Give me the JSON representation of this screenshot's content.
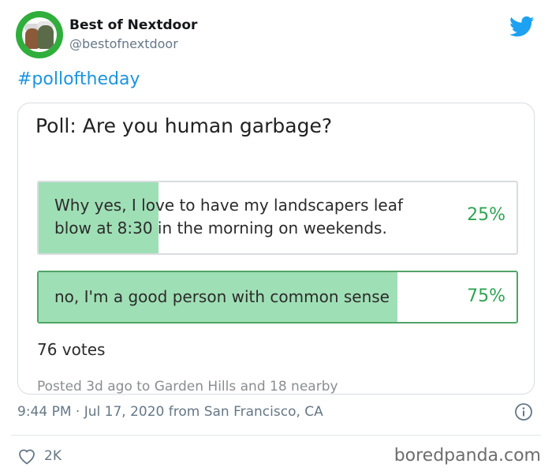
{
  "account": {
    "name": "Best of Nextdoor",
    "handle": "@bestofnextdoor",
    "avatar_icon": "muppets-avatar"
  },
  "tweet": {
    "hashtag": "#polloftheday"
  },
  "poll": {
    "title": "Poll: Are you human garbage?",
    "options": [
      {
        "text": "Why yes, I love to have my landscapers leaf blow at 8:30 in the morning on weekends.",
        "percent_label": "25%",
        "fraction": 0.25
      },
      {
        "text": "no, I'm a good person with common sense",
        "percent_label": "75%",
        "fraction": 0.75
      }
    ],
    "votes": "76 votes",
    "posted": "Posted 3d ago to Garden Hills and 18 nearby"
  },
  "meta": {
    "timestamp": "9:44 PM · Jul 17, 2020 from San Francisco, CA"
  },
  "actions": {
    "likes": "2K"
  },
  "watermark": "boredpanda.com",
  "colors": {
    "twitter_blue": "#1da1f2",
    "hashtag": "#1b95e0",
    "poll_fill": "#9fdfb5",
    "poll_percent": "#2fa452",
    "avatar_green": "#2fae3c"
  },
  "icons": {
    "brand": "twitter-bird-icon",
    "info": "info-icon",
    "like": "heart-icon"
  }
}
